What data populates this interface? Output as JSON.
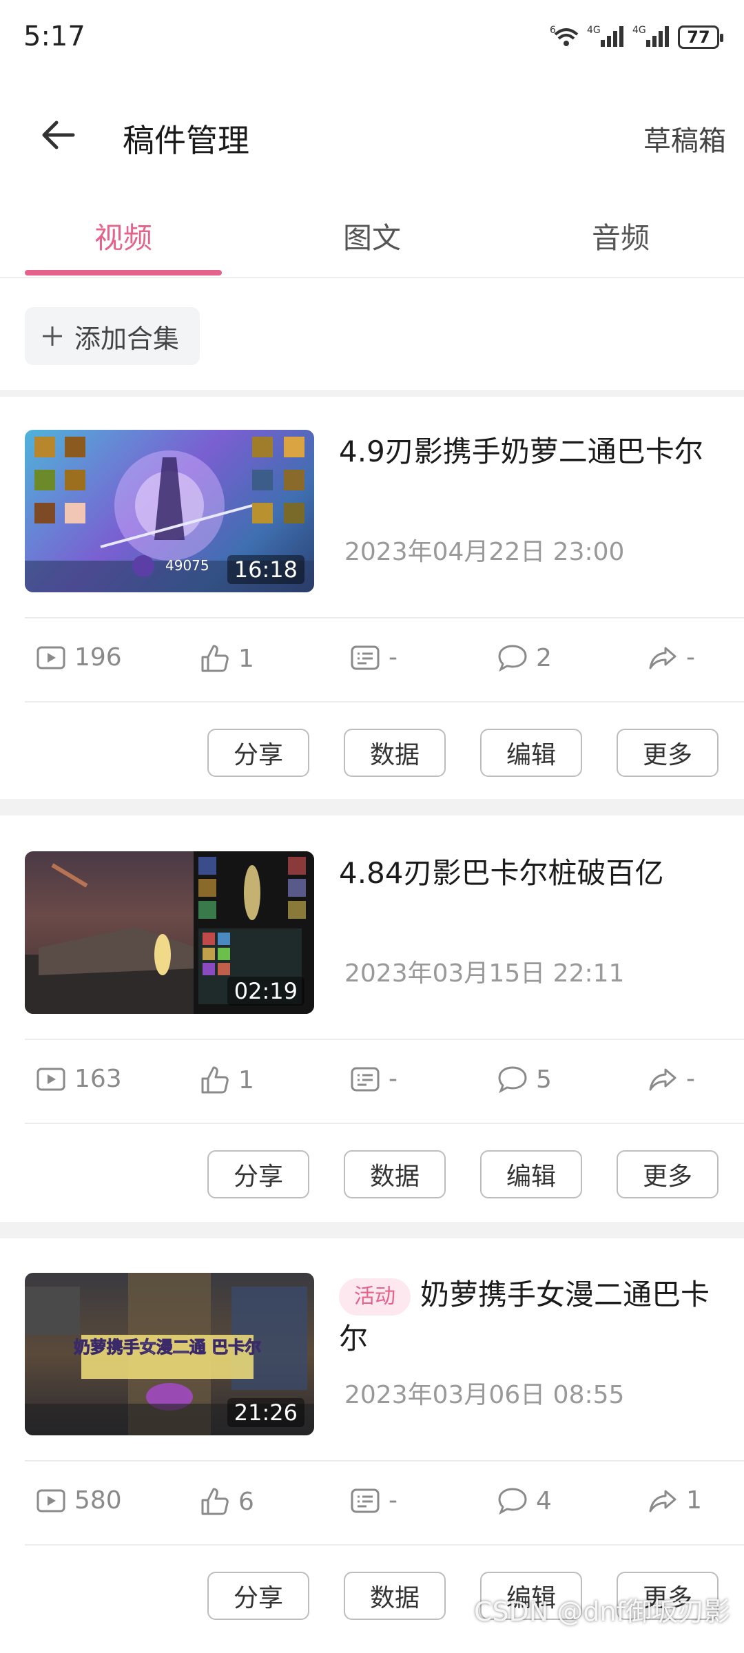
{
  "status": {
    "time": "5:17",
    "battery": "77",
    "net1": "4G",
    "net2": "4G",
    "wifi_tag": "6"
  },
  "header": {
    "title": "稿件管理",
    "drafts": "草稿箱"
  },
  "tabs": [
    {
      "label": "视频"
    },
    {
      "label": "图文"
    },
    {
      "label": "音频"
    }
  ],
  "add_collection": {
    "label": "添加合集"
  },
  "videos": [
    {
      "title": "4.9刃影携手奶萝二通巴卡尔",
      "date": "2023年04月22日 23:00",
      "duration": "16:18",
      "badge": "",
      "thumb_overlay": "49075",
      "stats": {
        "plays": "196",
        "likes": "1",
        "danmaku": "-",
        "comments": "2",
        "shares": "-"
      }
    },
    {
      "title": "4.84刃影巴卡尔桩破百亿",
      "date": "2023年03月15日 22:11",
      "duration": "02:19",
      "badge": "",
      "thumb_overlay": "",
      "stats": {
        "plays": "163",
        "likes": "1",
        "danmaku": "-",
        "comments": "5",
        "shares": "-"
      }
    },
    {
      "title": "奶萝携手女漫二通巴卡尔",
      "date": "2023年03月06日 08:55",
      "duration": "21:26",
      "badge": "活动",
      "thumb_overlay": "奶萝携手女漫二通 巴卡尔",
      "stats": {
        "plays": "580",
        "likes": "6",
        "danmaku": "-",
        "comments": "4",
        "shares": "1"
      }
    }
  ],
  "actions": {
    "share": "分享",
    "data": "数据",
    "edit": "编辑",
    "more": "更多"
  },
  "watermark": "CSDN @dnf御坂刃影",
  "colors": {
    "accent": "#e5628b",
    "text": "#1b1b1b",
    "muted": "#8a8a8a"
  }
}
